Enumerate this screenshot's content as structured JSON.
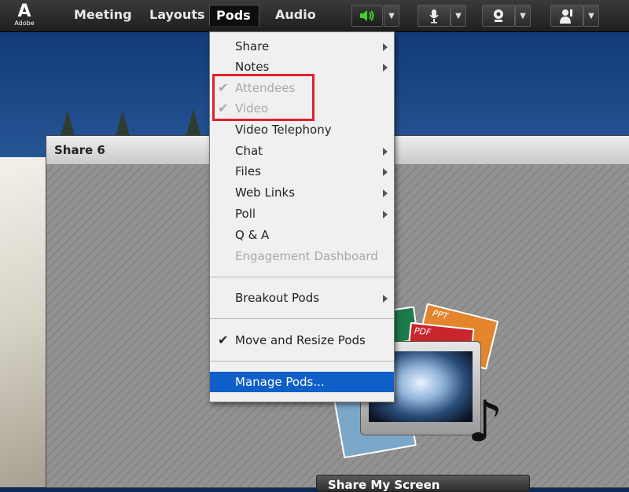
{
  "app": {
    "logo_text": "Adobe",
    "menu": [
      "Meeting",
      "Layouts",
      "Pods",
      "Audio"
    ],
    "active_menu": "Pods"
  },
  "toolbar": {
    "speaker_icon": "speaker-icon",
    "mic_icon": "microphone-icon",
    "webcam_icon": "webcam-icon",
    "raise_hand_icon": "raise-hand-icon"
  },
  "pod": {
    "title": "Share 6",
    "share_button_label": "Share My Screen"
  },
  "share_graphic": {
    "ppt_label": "PPT",
    "pdf_label": "PDF"
  },
  "pods_menu": {
    "items": [
      {
        "label": "Share",
        "submenu": true,
        "checked": false,
        "disabled": false
      },
      {
        "label": "Notes",
        "submenu": true,
        "checked": false,
        "disabled": false
      },
      {
        "label": "Attendees",
        "submenu": false,
        "checked": true,
        "disabled": true
      },
      {
        "label": "Video",
        "submenu": false,
        "checked": true,
        "disabled": true
      },
      {
        "label": "Video Telephony",
        "submenu": false,
        "checked": false,
        "disabled": false
      },
      {
        "label": "Chat",
        "submenu": true,
        "checked": false,
        "disabled": false
      },
      {
        "label": "Files",
        "submenu": true,
        "checked": false,
        "disabled": false
      },
      {
        "label": "Web Links",
        "submenu": true,
        "checked": false,
        "disabled": false
      },
      {
        "label": "Poll",
        "submenu": true,
        "checked": false,
        "disabled": false
      },
      {
        "label": "Q & A",
        "submenu": false,
        "checked": false,
        "disabled": false
      },
      {
        "label": "Engagement Dashboard",
        "submenu": false,
        "checked": false,
        "disabled": true
      },
      {
        "label": "Breakout Pods",
        "submenu": true,
        "checked": false,
        "disabled": false
      },
      {
        "label": "Move and Resize Pods",
        "submenu": false,
        "checked": true,
        "disabled": false
      },
      {
        "label": "Manage Pods...",
        "submenu": false,
        "checked": false,
        "disabled": false,
        "selected": true
      }
    ]
  },
  "colors": {
    "highlight_box": "#e0212a",
    "selected_item": "#0f5fc8",
    "speaker_active": "#3fd12a"
  }
}
